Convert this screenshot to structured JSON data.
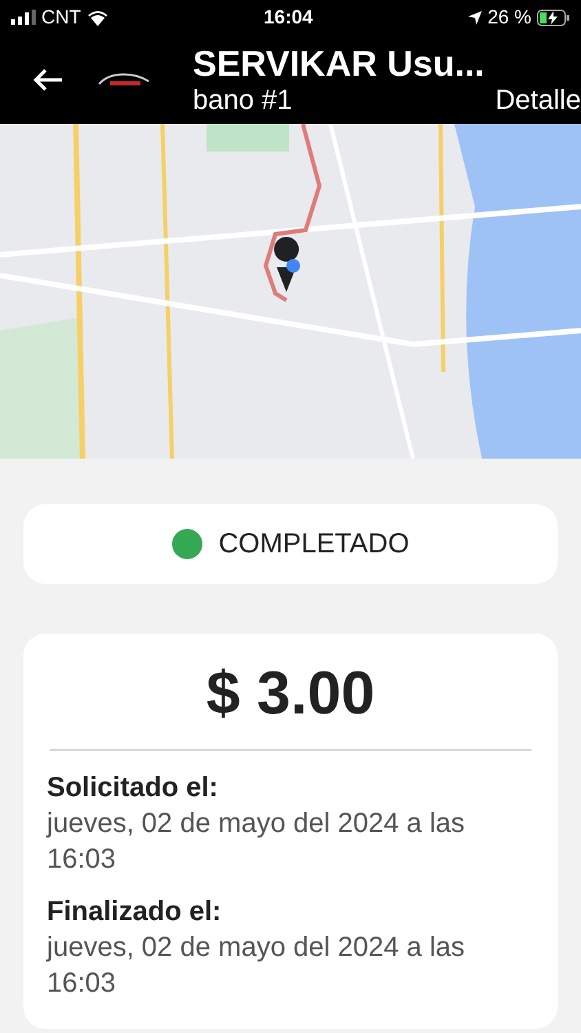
{
  "status_bar": {
    "carrier": "CNT",
    "time": "16:04",
    "battery": "26 %"
  },
  "header": {
    "title": "SERVIKAR Usu...",
    "subtitle_left": "bano #1",
    "subtitle_right": "Detalle"
  },
  "status": {
    "label": "COMPLETADO",
    "color": "#34a853"
  },
  "order": {
    "price": "$ 3.00",
    "details": [
      {
        "label": "Solicitado el:",
        "value": "jueves, 02 de mayo del 2024 a las 16:03"
      },
      {
        "label": "Finalizado el:",
        "value": "jueves, 02 de mayo del 2024 a las 16:03"
      }
    ]
  }
}
